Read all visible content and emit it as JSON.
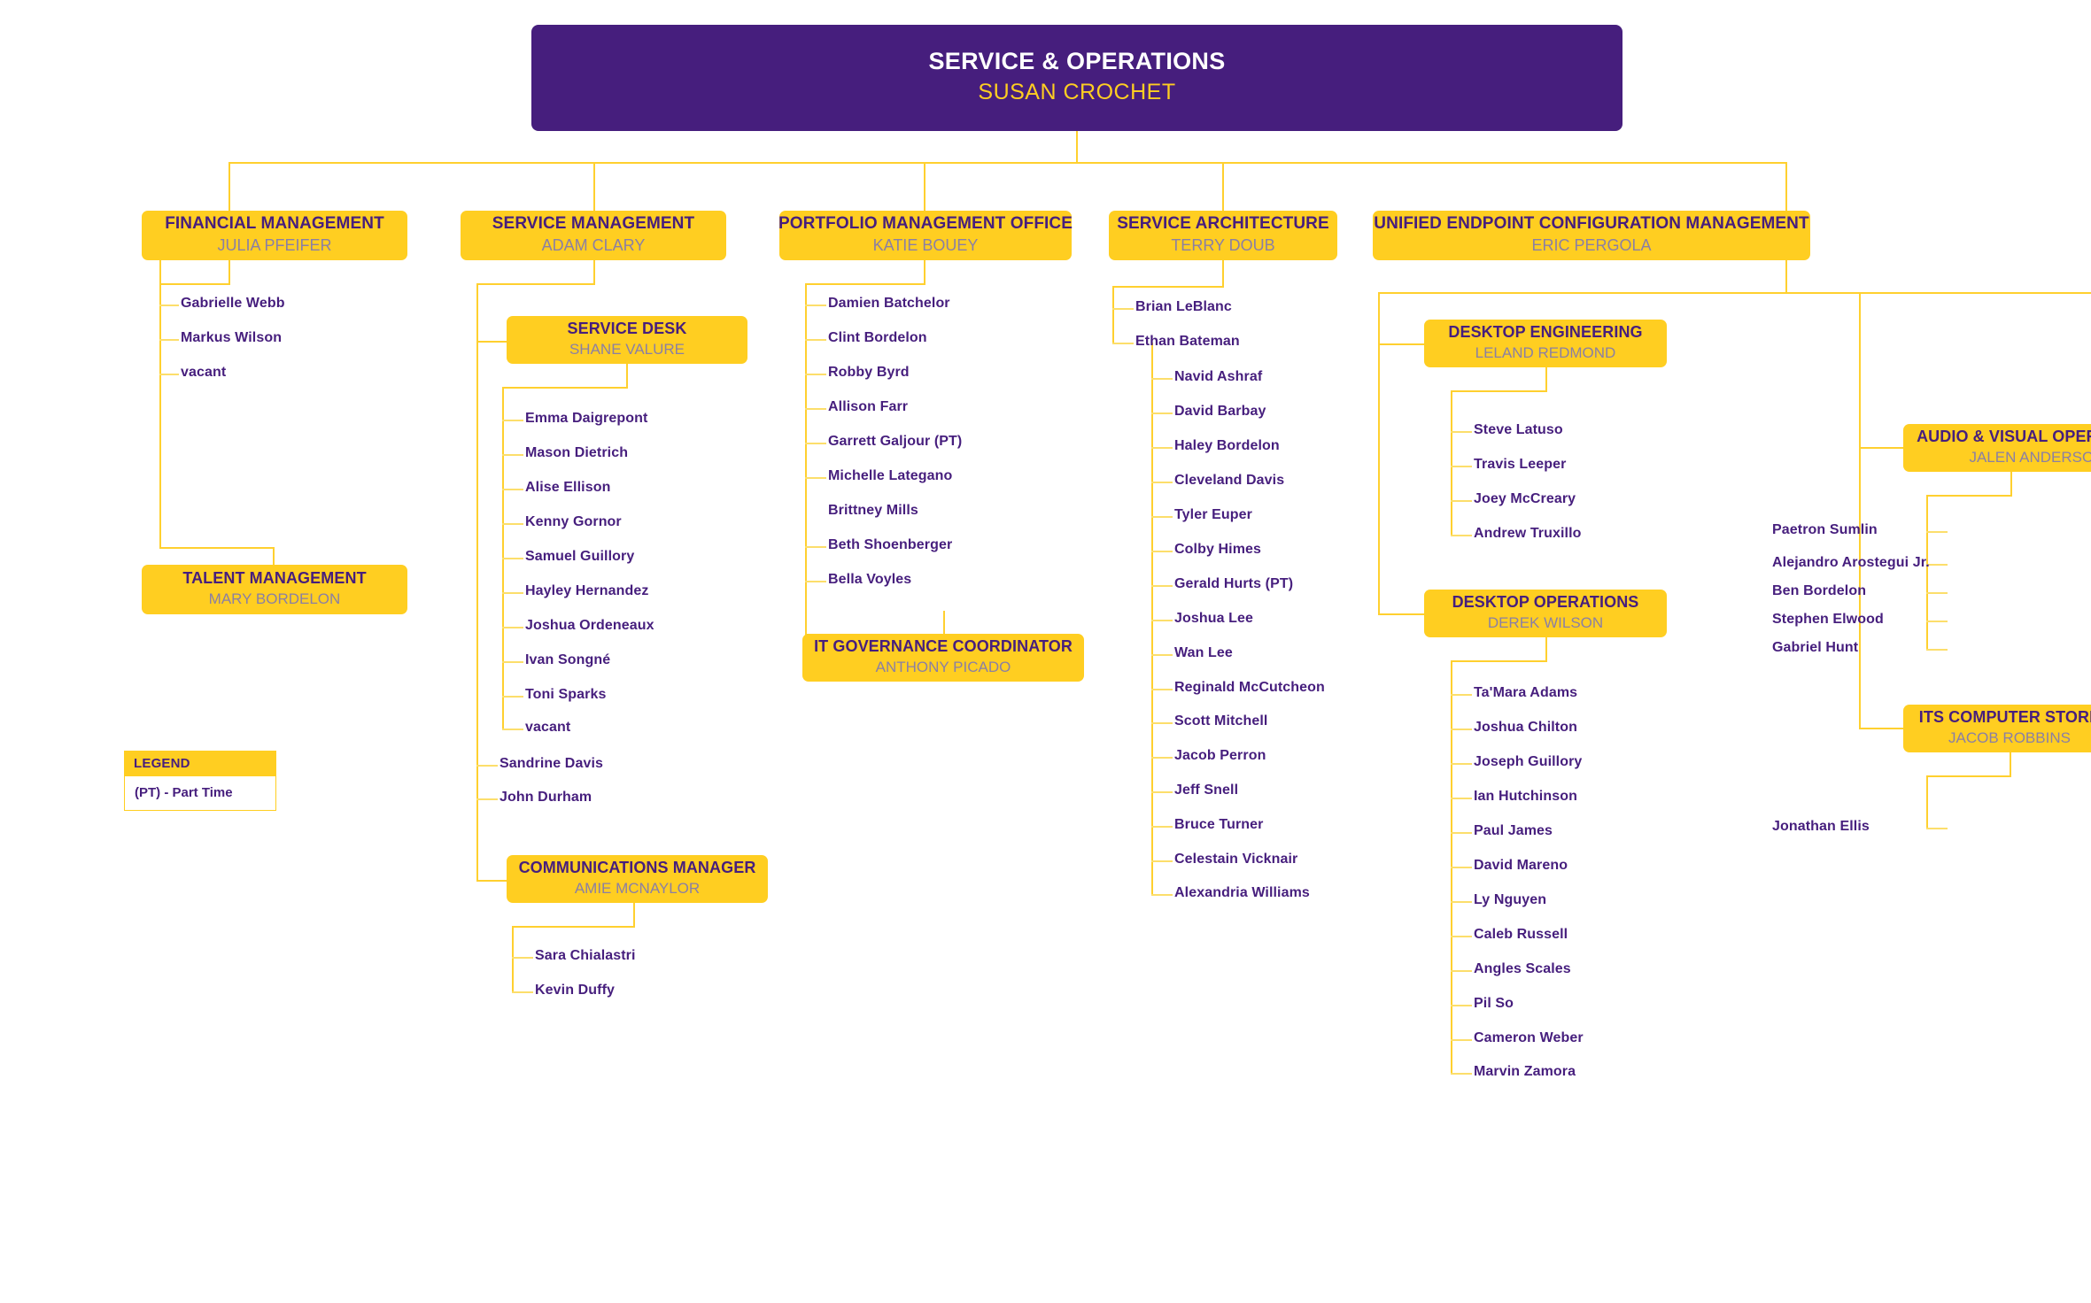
{
  "root": {
    "title": "SERVICE & OPERATIONS",
    "name": "SUSAN CROCHET"
  },
  "departments": {
    "financial_management": {
      "title": "FINANCIAL MANAGEMENT",
      "name": "JULIA PFEIFER"
    },
    "service_management": {
      "title": "SERVICE MANAGEMENT",
      "name": "ADAM CLARY"
    },
    "portfolio_management_office": {
      "title": "PORTFOLIO MANAGEMENT OFFICE",
      "name": "KATIE BOUEY"
    },
    "service_architecture": {
      "title": "SERVICE ARCHITECTURE",
      "name": "TERRY DOUB"
    },
    "unified_endpoint_configuration_management": {
      "title": "UNIFIED ENDPOINT CONFIGURATION MANAGEMENT",
      "name": "ERIC PERGOLA"
    },
    "talent_management": {
      "title": "TALENT MANAGEMENT",
      "name": "MARY BORDELON"
    },
    "service_desk": {
      "title": "SERVICE DESK",
      "name": "SHANE VALURE"
    },
    "communications_manager": {
      "title": "COMMUNICATIONS MANAGER",
      "name": "AMIE MCNAYLOR"
    },
    "it_governance_coordinator": {
      "title": "IT GOVERNANCE COORDINATOR",
      "name": "ANTHONY PICADO"
    },
    "desktop_engineering": {
      "title": "DESKTOP ENGINEERING",
      "name": "LELAND REDMOND"
    },
    "desktop_operations": {
      "title": "DESKTOP OPERATIONS",
      "name": "DEREK WILSON"
    },
    "audio_visual_operations": {
      "title": "AUDIO & VISUAL OPERATIONS",
      "name": "JALEN ANDERSON"
    },
    "its_computer_store": {
      "title": "ITS COMPUTER STORE",
      "name": "JACOB ROBBINS"
    }
  },
  "staff": {
    "financial_management": [
      "Gabrielle Webb",
      "Markus Wilson",
      "vacant"
    ],
    "service_desk": [
      "Emma Daigrepont",
      "Mason Dietrich",
      "Alise Ellison",
      "Kenny Gornor",
      "Samuel Guillory",
      "Hayley Hernandez",
      "Joshua Ordeneaux",
      "Ivan Songné",
      "Toni Sparks",
      "vacant"
    ],
    "service_management": [
      "Sandrine Davis",
      "John Durham"
    ],
    "communications_manager": [
      "Sara Chialastri",
      "Kevin Duffy"
    ],
    "portfolio_management_office": [
      "Damien Batchelor",
      "Clint Bordelon",
      "Robby Byrd",
      "Allison Farr",
      "Garrett Galjour (PT)",
      "Michelle Lategano",
      "Brittney Mills",
      "Beth Shoenberger",
      "Bella Voyles"
    ],
    "service_architecture": [
      "Brian LeBlanc",
      "Ethan Bateman"
    ],
    "ethan_bateman": [
      "Navid Ashraf",
      "David Barbay",
      "Haley Bordelon",
      "Cleveland Davis",
      "Tyler Euper",
      "Colby Himes",
      "Gerald Hurts (PT)",
      "Joshua Lee",
      "Wan Lee",
      "Reginald McCutcheon",
      "Scott Mitchell",
      "Jacob Perron",
      "Jeff Snell",
      "Bruce Turner",
      "Celestain Vicknair",
      "Alexandria Williams"
    ],
    "desktop_engineering": [
      "Steve Latuso",
      "Travis Leeper",
      "Joey McCreary",
      "Andrew Truxillo"
    ],
    "desktop_operations": [
      "Ta'Mara Adams",
      "Joshua Chilton",
      "Joseph Guillory",
      "Ian Hutchinson",
      "Paul James",
      "David Mareno",
      "Ly Nguyen",
      "Caleb Russell",
      "Angles Scales",
      "Pil So",
      "Cameron Weber",
      "Marvin Zamora"
    ],
    "audio_visual_operations": [
      "Paetron Sumlin",
      "Alejandro Arostegui Jr.",
      "Ben Bordelon",
      "Stephen Elwood",
      "Gabriel Hunt"
    ],
    "its_computer_store": [
      "Jonathan Ellis"
    ]
  },
  "legend": {
    "header": "LEGEND",
    "entry": "(PT) - Part Time"
  },
  "colors": {
    "purple": "#461E7D",
    "gold": "#FFCE21",
    "line": "#FFD02F",
    "name_gray": "#8A7FA5",
    "background": "#FFFFFF"
  }
}
